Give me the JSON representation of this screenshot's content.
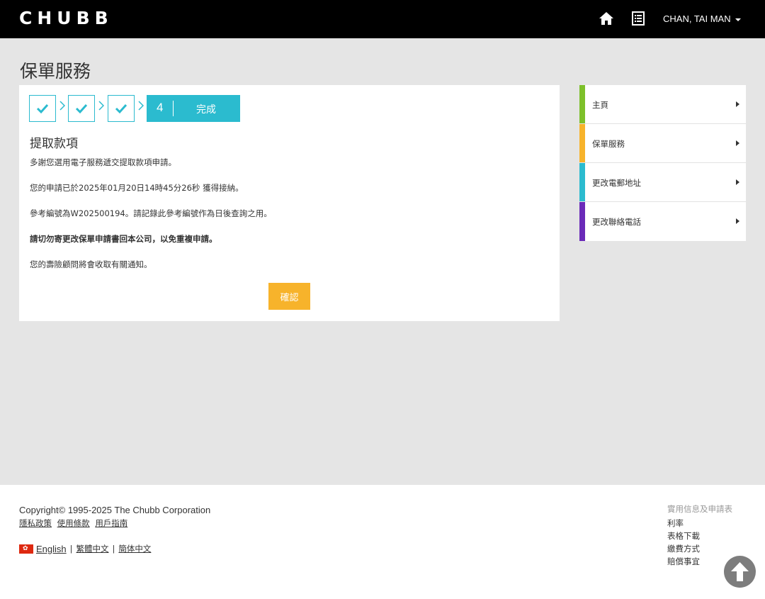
{
  "header": {
    "logo": "CHUBB",
    "user_name": "CHAN, TAI MAN",
    "icons": [
      "home-icon",
      "document-list-icon",
      "chevron-down-icon"
    ]
  },
  "page_title": "保單服務",
  "steps": {
    "completed": [
      "check-icon",
      "check-icon",
      "check-icon"
    ],
    "current_number": "4",
    "current_label": "完成"
  },
  "content": {
    "heading": "提取款項",
    "paragraphs": [
      "多謝您選用電子服務遞交提取款項申請。",
      "您的申請已於2025年01月20日14時45分26秒 獲得接納。",
      "參考編號為W202500194。請記錄此參考編號作為日後查詢之用。",
      "請切勿寄更改保單申請書回本公司，以免重複申請。",
      "您的壽險顧問將會收取有關通知。"
    ],
    "confirm_label": "確認"
  },
  "sidebar": {
    "items": [
      {
        "label": "主頁",
        "color": "#7dc02a"
      },
      {
        "label": "保單服務",
        "color": "#f7b32b"
      },
      {
        "label": "更改電郵地址",
        "color": "#2bbbcf"
      },
      {
        "label": "更改聯絡電話",
        "color": "#6a2ab8"
      }
    ]
  },
  "footer": {
    "copyright": "Copyright© 1995-2025 The Chubb Corporation",
    "links": [
      "隱私政策",
      "使用條款",
      "用戶指南"
    ],
    "languages": [
      "English",
      "繁體中文",
      "簡体中文"
    ],
    "useful_title": "實用信息及申請表",
    "useful_items": [
      "利率",
      "表格下載",
      "繳費方式",
      "賠償事宜"
    ]
  },
  "colors": {
    "accent_teal": "#2bbbcf",
    "button_yellow": "#f7b32b",
    "header_bg": "#000000"
  }
}
